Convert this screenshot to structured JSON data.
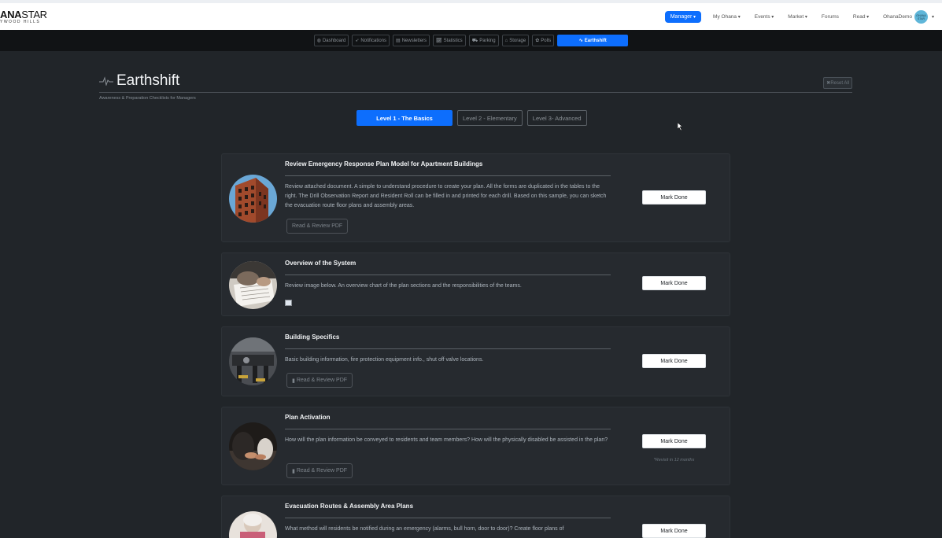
{
  "topnav": {
    "logo_brand_bold": "ANA",
    "logo_brand_rest": "STAR",
    "logo_sub": "YWOOD HILLS",
    "manager_label": "Manager",
    "links": [
      {
        "label": "My Ohana",
        "dropdown": true
      },
      {
        "label": "Events",
        "dropdown": true
      },
      {
        "label": "Market",
        "dropdown": true
      },
      {
        "label": "Forums",
        "dropdown": false
      },
      {
        "label": "Read",
        "dropdown": true
      },
      {
        "label": "OhanaDemo",
        "dropdown": false
      }
    ],
    "avatar_text": "OHANA STAR"
  },
  "subnav": {
    "tabs": [
      {
        "icon": "dashboard-icon",
        "label": "Dashboard"
      },
      {
        "icon": "paper-plane-icon",
        "label": "Notifications"
      },
      {
        "icon": "inbox-icon",
        "label": "Newsletters"
      },
      {
        "icon": "chart-icon",
        "label": "Statistics"
      },
      {
        "icon": "car-icon",
        "label": "Parking"
      },
      {
        "icon": "warehouse-icon",
        "label": "Storage"
      },
      {
        "icon": "palette-icon",
        "label": "Polls"
      }
    ],
    "active_tab": {
      "icon": "pulse-icon",
      "label": "Earthshift"
    }
  },
  "header": {
    "title": "Earthshift",
    "subtitle": "Awareness & Preparation Checklists for Managers",
    "reset_label": "Reset All"
  },
  "levels": [
    {
      "label": "Level 1 - The Basics",
      "active": true
    },
    {
      "label": "Level 2 - Elementary",
      "active": false
    },
    {
      "label": "Level 3- Advanced",
      "active": false
    }
  ],
  "cards": [
    {
      "title": "Review Emergency Response Plan Model for Apartment Buildings",
      "description": "Review attached document. A simple to understand procedure to create your plan. All the forms are duplicated in the tables to the right. The Drill Observation Report and Resident Roll can be filled in and printed for each drill. Based on this sample, you can sketch the evacuation route floor plans and assembly areas.",
      "pdf_label": "Read & Review PDF",
      "mark_label": "Mark Done"
    },
    {
      "title": "Overview of the System",
      "description": "Review image below. An overview chart of the plan sections and the responsibilities of the teams.",
      "mark_label": "Mark Done"
    },
    {
      "title": "Building Specifics",
      "description": "Basic building information, fire protection equipment info., shut off valve locations.",
      "pdf_label": "Read & Review PDF",
      "mark_label": "Mark Done"
    },
    {
      "title": "Plan Activation",
      "description": "How will the plan information be conveyed to residents and team members? How will the physically disabled be assisted in the plan?",
      "pdf_label": "Read & Review PDF",
      "mark_label": "Mark Done",
      "revisit": "*Revisit in 12 months"
    },
    {
      "title": "Evacuation Routes & Assembly Area Plans",
      "description": "What method will residents be notified during an emergency (alarms, bull horn, door to door)? Create floor plans of",
      "mark_label": "Mark Done"
    }
  ],
  "colors": {
    "accent": "#0d6efd",
    "page_bg": "#212529",
    "card_bg": "#262a2f",
    "subnav_bg": "#111315"
  }
}
